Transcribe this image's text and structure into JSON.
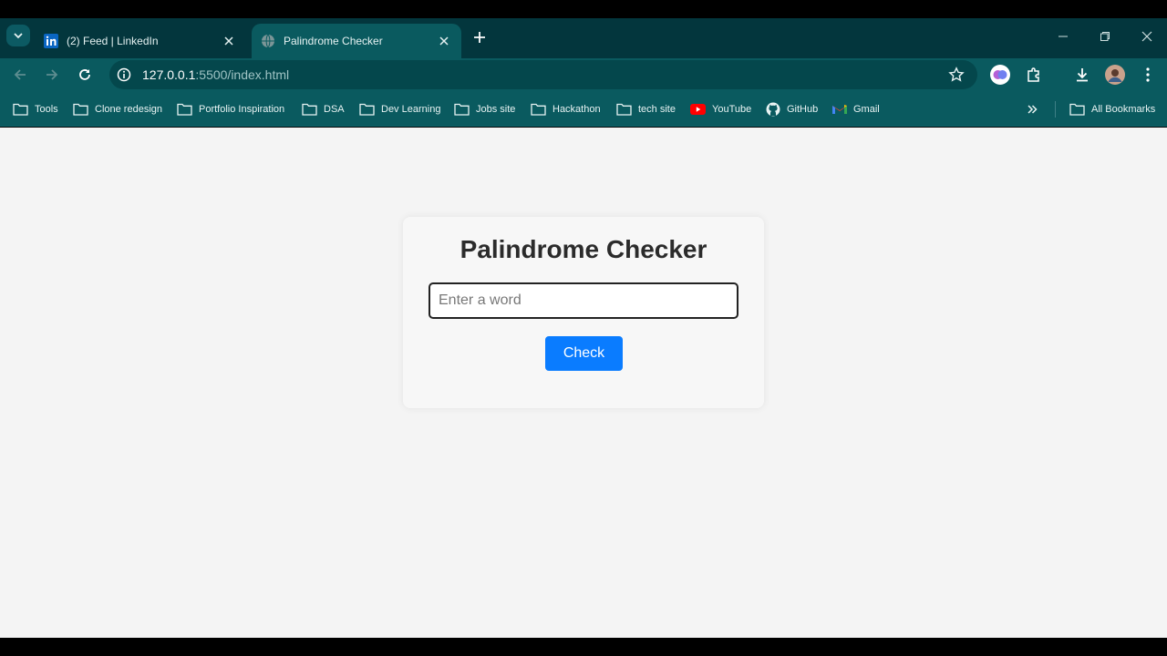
{
  "browser": {
    "tabs": [
      {
        "title": "(2) Feed | LinkedIn",
        "active": false,
        "favicon": "linkedin-icon"
      },
      {
        "title": "Palindrome Checker",
        "active": true,
        "favicon": "globe-icon"
      }
    ],
    "address": {
      "host": "127.0.0.1",
      "rest": ":5500/index.html"
    },
    "bookmarks": [
      {
        "label": "Tools",
        "icon": "folder-icon"
      },
      {
        "label": "Clone redesign",
        "icon": "folder-icon"
      },
      {
        "label": "Portfolio Inspiration",
        "icon": "folder-icon"
      },
      {
        "label": "DSA",
        "icon": "folder-icon"
      },
      {
        "label": "Dev Learning",
        "icon": "folder-icon"
      },
      {
        "label": "Jobs site",
        "icon": "folder-icon"
      },
      {
        "label": "Hackathon",
        "icon": "folder-icon"
      },
      {
        "label": "tech site",
        "icon": "folder-icon"
      },
      {
        "label": "YouTube",
        "icon": "youtube-icon"
      },
      {
        "label": "GitHub",
        "icon": "github-icon"
      },
      {
        "label": "Gmail",
        "icon": "gmail-icon"
      }
    ],
    "all_bookmarks": "All Bookmarks",
    "colors": {
      "tabstrip": "#03363d",
      "toolbar": "#0a5a5f",
      "omnibox": "#04474c"
    }
  },
  "app": {
    "title": "Palindrome Checker",
    "input_placeholder": "Enter a word",
    "input_value": "",
    "button_label": "Check",
    "colors": {
      "button": "#0a7cff",
      "page_bg": "#f4f4f4"
    }
  }
}
